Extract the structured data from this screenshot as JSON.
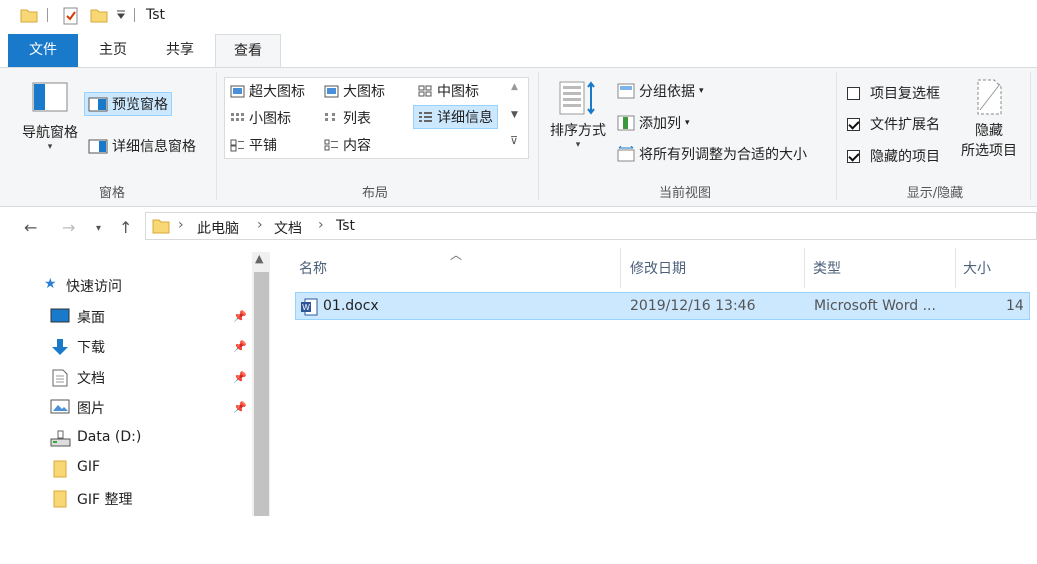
{
  "title_bar": {
    "title": "Tst"
  },
  "tabs": {
    "file": "文件",
    "home": "主页",
    "share": "共享",
    "view": "查看"
  },
  "ribbon": {
    "panes": {
      "nav_pane": "导航窗格",
      "preview_pane": "预览窗格",
      "details_pane": "详细信息窗格",
      "group_label": "窗格"
    },
    "layout": {
      "extra_large": "超大图标",
      "large": "大图标",
      "medium": "中图标",
      "small": "小图标",
      "list": "列表",
      "details": "详细信息",
      "tiles": "平铺",
      "content": "内容",
      "group_label": "布局"
    },
    "current_view": {
      "sort_by": "排序方式",
      "group_by": "分组依据",
      "add_column": "添加列",
      "size_all_columns": "将所有列调整为合适的大小",
      "group_label": "当前视图"
    },
    "show_hide": {
      "item_checkboxes": "项目复选框",
      "item_checkboxes_checked": false,
      "file_extensions": "文件扩展名",
      "file_extensions_checked": true,
      "hidden_items": "隐藏的项目",
      "hidden_items_checked": true,
      "hide_selected_line1": "隐藏",
      "hide_selected_line2": "所选项目",
      "group_label": "显示/隐藏"
    }
  },
  "address": {
    "crumbs": [
      "此电脑",
      "文档",
      "Tst"
    ]
  },
  "nav_pane": {
    "quick_access": "快速访问",
    "items": [
      {
        "label": "桌面",
        "pinned": true
      },
      {
        "label": "下载",
        "pinned": true
      },
      {
        "label": "文档",
        "pinned": true
      },
      {
        "label": "图片",
        "pinned": true
      },
      {
        "label": "Data (D:)",
        "pinned": false
      },
      {
        "label": "GIF",
        "pinned": false
      },
      {
        "label": "GIF 整理",
        "pinned": false
      }
    ]
  },
  "columns": {
    "name": "名称",
    "modified": "修改日期",
    "type": "类型",
    "size": "大小"
  },
  "files": [
    {
      "name": "01.docx",
      "modified": "2019/12/16 13:46",
      "type": "Microsoft Word ...",
      "size": "14"
    }
  ],
  "colors": {
    "accent": "#1979ca",
    "selection": "#cce8ff",
    "selection_border": "#99d1ff",
    "folder": "#f8d775"
  }
}
